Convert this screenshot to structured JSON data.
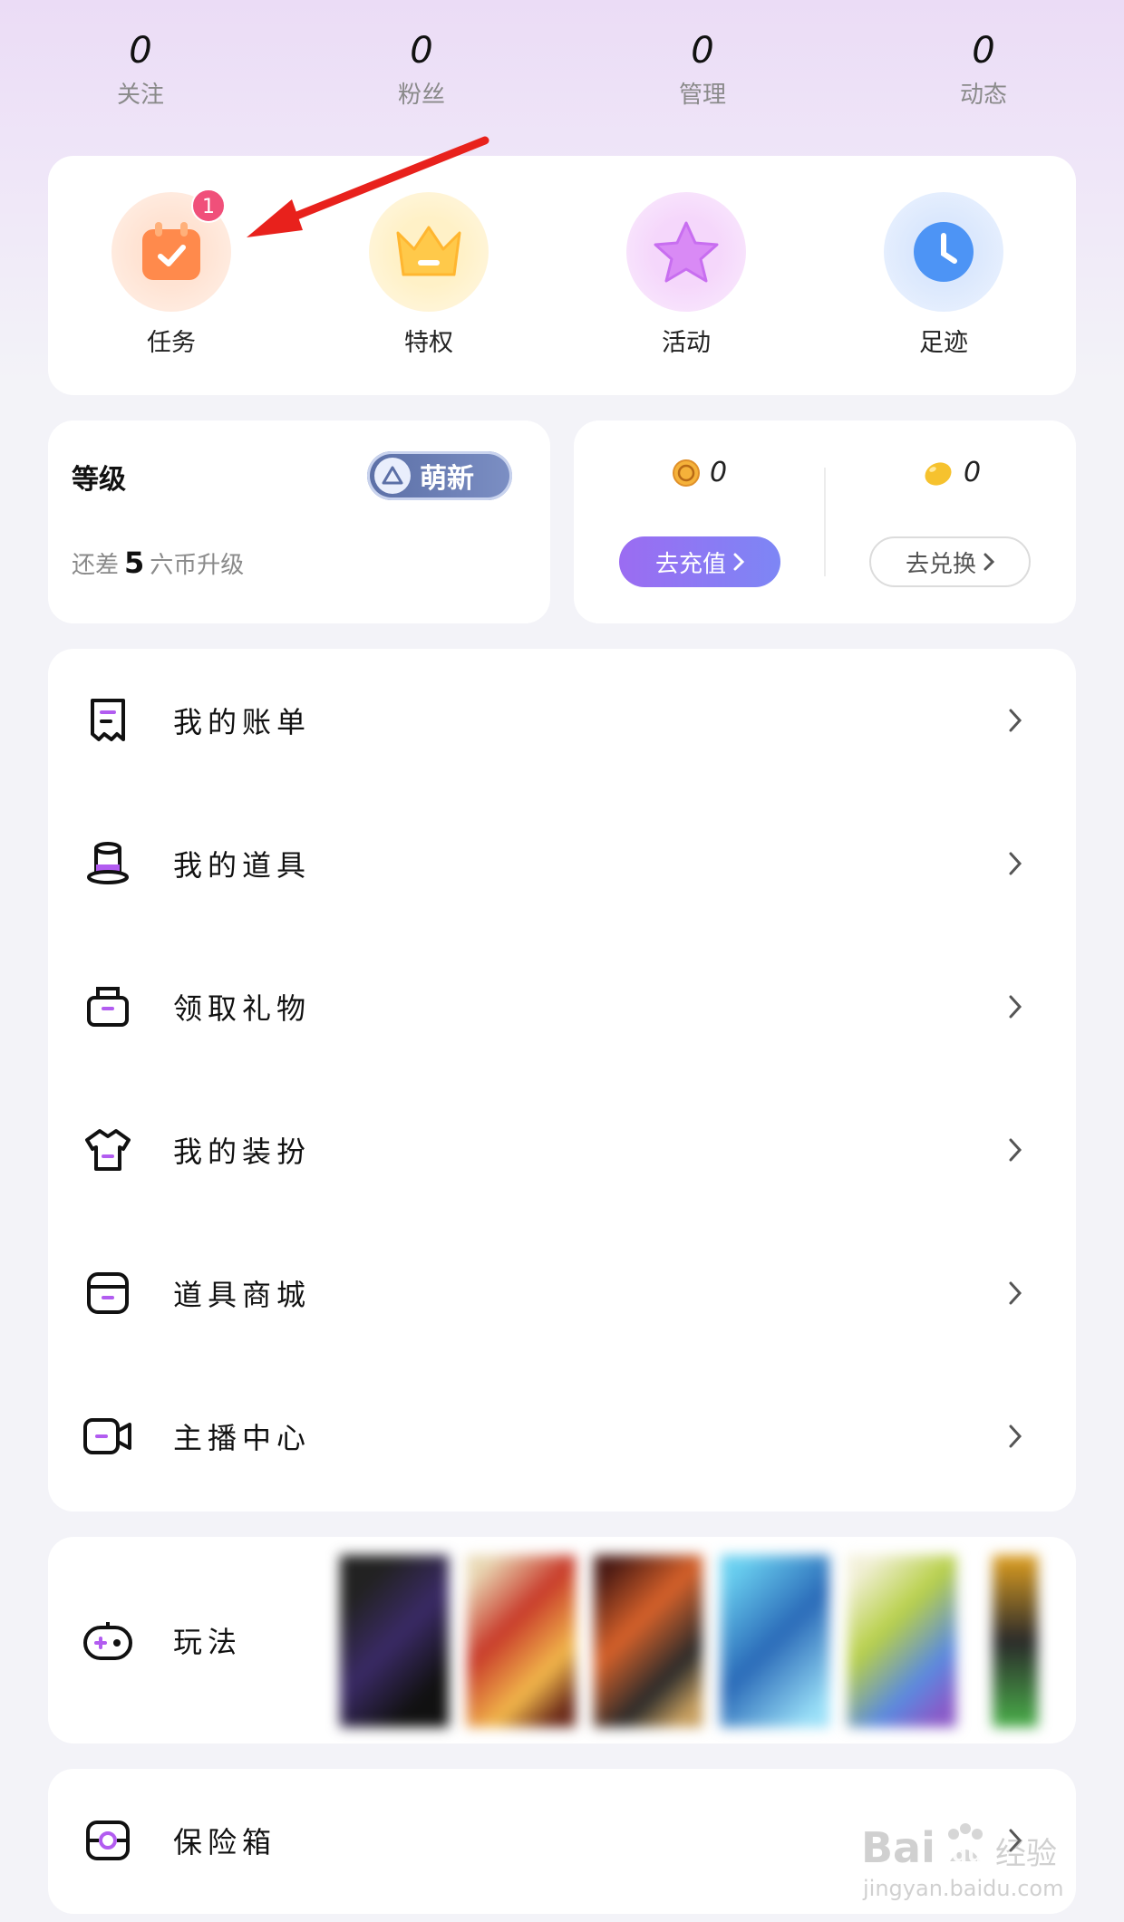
{
  "stats": [
    {
      "value": "0",
      "label": "关注"
    },
    {
      "value": "0",
      "label": "粉丝"
    },
    {
      "value": "0",
      "label": "管理"
    },
    {
      "value": "0",
      "label": "动态"
    }
  ],
  "quick": [
    {
      "label": "任务",
      "badge": "1",
      "icon": "calendar-check-icon",
      "color": "#ff8a4c"
    },
    {
      "label": "特权",
      "icon": "crown-icon",
      "color": "#ffc94a"
    },
    {
      "label": "活动",
      "icon": "star-icon",
      "color": "#d98af5"
    },
    {
      "label": "足迹",
      "icon": "clock-icon",
      "color": "#4d94f5"
    }
  ],
  "level": {
    "title": "等级",
    "badge": "萌新",
    "sub_prefix": "还差",
    "sub_number": "5",
    "sub_suffix": "六币升级"
  },
  "wallet": {
    "coins_value": "0",
    "beans_value": "0",
    "recharge_label": "去充值",
    "exchange_label": "去兑换"
  },
  "menu": [
    {
      "label": "我的账单",
      "icon": "receipt-icon"
    },
    {
      "label": "我的道具",
      "icon": "hat-icon"
    },
    {
      "label": "领取礼物",
      "icon": "gift-icon"
    },
    {
      "label": "我的装扮",
      "icon": "shirt-icon"
    },
    {
      "label": "道具商城",
      "icon": "store-icon"
    },
    {
      "label": "主播中心",
      "icon": "camera-icon"
    }
  ],
  "play": {
    "label": "玩法",
    "icon": "gamepad-icon"
  },
  "safe": {
    "label": "保险箱",
    "icon": "safe-icon"
  },
  "watermark": {
    "brand": "Bai",
    "brand2": "du",
    "suffix": "经验",
    "url": "jingyan.baidu.com"
  },
  "colors": {
    "accent_purple": "#9b6cf2",
    "badge_red": "#f0507a",
    "menu_icon_accent": "#b25cf0"
  }
}
